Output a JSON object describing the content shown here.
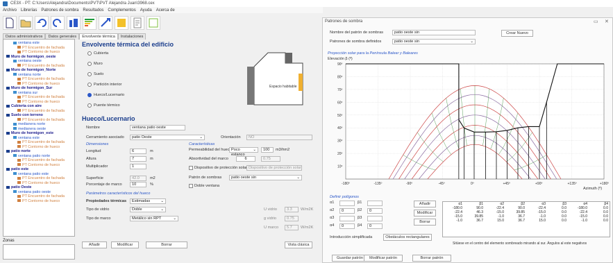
{
  "app": {
    "title": "CE3X - PT: C:\\Users\\Alejandra\\Documents\\PVT\\PVT Alejandra Juan\\3968.cex"
  },
  "menu": [
    "Archivo",
    "Librerías",
    "Patrones de sombra",
    "Resultados",
    "Complementos",
    "Ayuda",
    "Acerca de"
  ],
  "tabs": [
    "Datos administrativos",
    "Datos generales",
    "Envolvente térmica",
    "Instalaciones"
  ],
  "tree": [
    {
      "lvl": "l2",
      "label": "ventana este"
    },
    {
      "lvl": "l3",
      "label": "PT Encuentro de fachada"
    },
    {
      "lvl": "l3",
      "label": "PT Contorno de hueco"
    },
    {
      "lvl": "l1",
      "label": "Muro de hormigon_oeste"
    },
    {
      "lvl": "l2",
      "label": "ventana oeste"
    },
    {
      "lvl": "l3",
      "label": "PT Encuentro de fachada"
    },
    {
      "lvl": "l1",
      "label": "Muro de hormigon_Norte"
    },
    {
      "lvl": "l2",
      "label": "ventana norte"
    },
    {
      "lvl": "l3",
      "label": "PT Encuentro de fachada"
    },
    {
      "lvl": "l3",
      "label": "PT Contorno de hueco"
    },
    {
      "lvl": "l1",
      "label": "Muro de hormigon_Sur"
    },
    {
      "lvl": "l2",
      "label": "ventana sur"
    },
    {
      "lvl": "l3",
      "label": "PT Encuentro de fachada"
    },
    {
      "lvl": "l3",
      "label": "PT Contorno de hueco"
    },
    {
      "lvl": "l1",
      "label": "Cubierta con aire"
    },
    {
      "lvl": "l3",
      "label": "PT Encuentro de fachada"
    },
    {
      "lvl": "l1",
      "label": "Suelo con terreno"
    },
    {
      "lvl": "l3",
      "label": "PT Encuentro de fachada"
    },
    {
      "lvl": "l2",
      "label": "medianera norte"
    },
    {
      "lvl": "l2",
      "label": "medianera oeste"
    },
    {
      "lvl": "l1",
      "label": "Muro de hormigon_este"
    },
    {
      "lvl": "l2",
      "label": "ventana este"
    },
    {
      "lvl": "l3",
      "label": "PT Encuentro de fachada"
    },
    {
      "lvl": "l3",
      "label": "PT Contorno de hueco"
    },
    {
      "lvl": "l1",
      "label": "patio norte"
    },
    {
      "lvl": "l2",
      "label": "ventana patio norte"
    },
    {
      "lvl": "l3",
      "label": "PT Encuentro de fachada"
    },
    {
      "lvl": "l3",
      "label": "PT Contorno de hueco"
    },
    {
      "lvl": "l1",
      "label": "patio este"
    },
    {
      "lvl": "l2",
      "label": "ventana patio este"
    },
    {
      "lvl": "l3",
      "label": "PT Encuentro de fachada"
    },
    {
      "lvl": "l3",
      "label": "PT Contorno de hueco"
    },
    {
      "lvl": "l1",
      "label": "patio Oeste"
    },
    {
      "lvl": "l2",
      "label": "ventana patio oeste"
    },
    {
      "lvl": "l3",
      "label": "PT Encuentro de fachada"
    },
    {
      "lvl": "l3",
      "label": "PT Contorno de hueco"
    }
  ],
  "zones_label": "Zonas",
  "envolvente": {
    "title": "Envolvente térmica del edificio",
    "options": [
      "Cubierta",
      "Muro",
      "Suelo",
      "Partición interior",
      "Hueco/Lucernario",
      "Puente térmico"
    ],
    "selected": "Hueco/Lucernario",
    "sketch_label": "Espacio habitable"
  },
  "hueco": {
    "title": "Hueco/Lucernario",
    "nombre_lbl": "Nombre",
    "nombre": "ventana patio oeste",
    "cerr_lbl": "Cerramiento asociado",
    "cerr": "patio Oeste",
    "orient_lbl": "Orientación",
    "orient": "NO",
    "dim_lbl": "Dimensiones",
    "long_lbl": "Longitud",
    "long": "6",
    "long_u": "m",
    "alto_lbl": "Altura",
    "alto": "7",
    "alto_u": "m",
    "mult_lbl": "Multiplicador",
    "mult": "1",
    "sup_lbl": "Superficie",
    "sup": "42.0",
    "sup_u": "m2",
    "pct_lbl": "Porcentaje de marco",
    "pct": "10",
    "pct_u": "%",
    "car_lbl": "Características",
    "perm_lbl": "Permeabilidad del hueco",
    "perm_sel": "Poco estanco",
    "perm_val": "100",
    "perm_u": "m3/hm2",
    "abs_lbl": "Absortividad del marco",
    "abs_mid": "6",
    "abs_val": "0.75",
    "disp_lbl": "Dispositivo de protección solar",
    "disp_val": "Dispositivo de protección solar",
    "patron_lbl": "Patrón de sombras",
    "patron_val": "patio oeste sin",
    "doble_lbl": "Doble ventana",
    "param_lbl": "Parámetros característicos del hueco",
    "prop_lbl": "Propiedades térmicas",
    "prop_val": "Estimadas",
    "vidrio_lbl": "Tipo de vidrio",
    "vidrio_val": "Doble",
    "marco_lbl": "Tipo de marco",
    "marco_val": "Metálico sin RPT",
    "uv_lbl": "U vidrio",
    "uv": "3.3",
    "uv_u": "W/m2K",
    "gv_lbl": "g vidrio",
    "gv": "0.75",
    "um_lbl": "U marco",
    "um": "5.7",
    "um_u": "W/m2K",
    "btn_add": "Añadir",
    "btn_mod": "Modificar",
    "btn_del": "Borrar",
    "btn_vista": "Vista clásica"
  },
  "shadow": {
    "title": "Patrones de sombra",
    "nombre_lbl": "Nombre del patrón de sombras",
    "nombre": "patio oeste sin",
    "def_lbl": "Patrones de sombra definidos",
    "def": "patio oeste sin",
    "create": "Crear Nuevo",
    "chart_title": "Proyección solar para la Península Balear y Baleares",
    "btn_save": "Guardar patrón",
    "btn_mod": "Modificar patrón",
    "btn_del": "Borrar patrón",
    "poly_lbl": "Definir polígonos",
    "poly_rows": [
      {
        "a": "α1",
        "b": "β1"
      },
      {
        "a": "α2",
        "b": "β2"
      },
      {
        "a": "α3",
        "b": "β3"
      },
      {
        "a": "α4",
        "b": "β4"
      }
    ],
    "poly_vals": [
      "",
      "",
      "0",
      "0",
      "",
      "",
      "0",
      "0"
    ],
    "poly_btns": [
      "Añadir",
      "Modificar",
      "Borrar"
    ],
    "simpl_lbl": "Introducción simplificada",
    "obst_btn": "Obstáculos rectangulares",
    "note": "Sitúese en el centro del elemento sombreado mirando al sur. Ángulos al este negativos",
    "table_head": [
      "α1",
      "β1",
      "α2",
      "β2",
      "α3",
      "β3",
      "α4",
      "β4"
    ],
    "table_rows": [
      [
        "-180.0",
        "90.0",
        "-22.4",
        "90.0",
        "-22.4",
        "0.0",
        "-180.0",
        "0.0"
      ],
      [
        "-22.4",
        "46.3",
        "-15.0",
        "39.85",
        "-15.0",
        "0.0",
        "-22.4",
        "0.0"
      ],
      [
        "-15.0",
        "39.85",
        "-1.0",
        "36.7",
        "-1.0",
        "0.0",
        "-15.0",
        "0.0"
      ],
      [
        "-1.0",
        "36.7",
        "15.0",
        "36.7",
        "15.0",
        "0.0",
        "-1.0",
        "0.0"
      ]
    ]
  },
  "chart_data": {
    "type": "line",
    "title": "Proyección solar para la Península Balear y Baleares",
    "ylabel": "Elevación β (º)",
    "xlabel": "Azimuth (º)",
    "xlim": [
      -180,
      180
    ],
    "ylim": [
      0,
      90
    ],
    "xticks": [
      "-180º",
      "-135º",
      "-90º",
      "-45º",
      "0º",
      "+45º",
      "+90º",
      "+135º",
      "+180º"
    ],
    "yticks": [
      "10º",
      "20º",
      "30º",
      "40º",
      "50º",
      "60º",
      "70º",
      "80º",
      "90º"
    ],
    "obstacle": [
      [
        -180,
        90
      ],
      [
        -22.4,
        90
      ],
      [
        -22.4,
        46.3
      ],
      [
        -15,
        39.85
      ],
      [
        -1,
        36.7
      ],
      [
        15,
        36.7
      ],
      [
        30,
        37
      ],
      [
        45,
        38
      ],
      [
        60,
        40
      ],
      [
        75,
        41
      ],
      [
        90,
        41
      ],
      [
        100,
        60
      ],
      [
        115,
        90
      ],
      [
        180,
        90
      ]
    ],
    "sun_series": [
      {
        "name": "",
        "peak": 73,
        "span": 120
      },
      {
        "name": "",
        "peak": 66,
        "span": 114
      },
      {
        "name": "",
        "peak": 58,
        "span": 106
      },
      {
        "name": "",
        "peak": 50,
        "span": 98
      },
      {
        "name": "",
        "peak": 42,
        "span": 88
      },
      {
        "name": "",
        "peak": 34,
        "span": 78
      },
      {
        "name": "",
        "peak": 27,
        "span": 66
      }
    ],
    "grid": true,
    "colors": {
      "sun": "#c44",
      "grid": "#cfcfcf",
      "obstacle": "#111",
      "hour": "#5aa05a"
    }
  }
}
